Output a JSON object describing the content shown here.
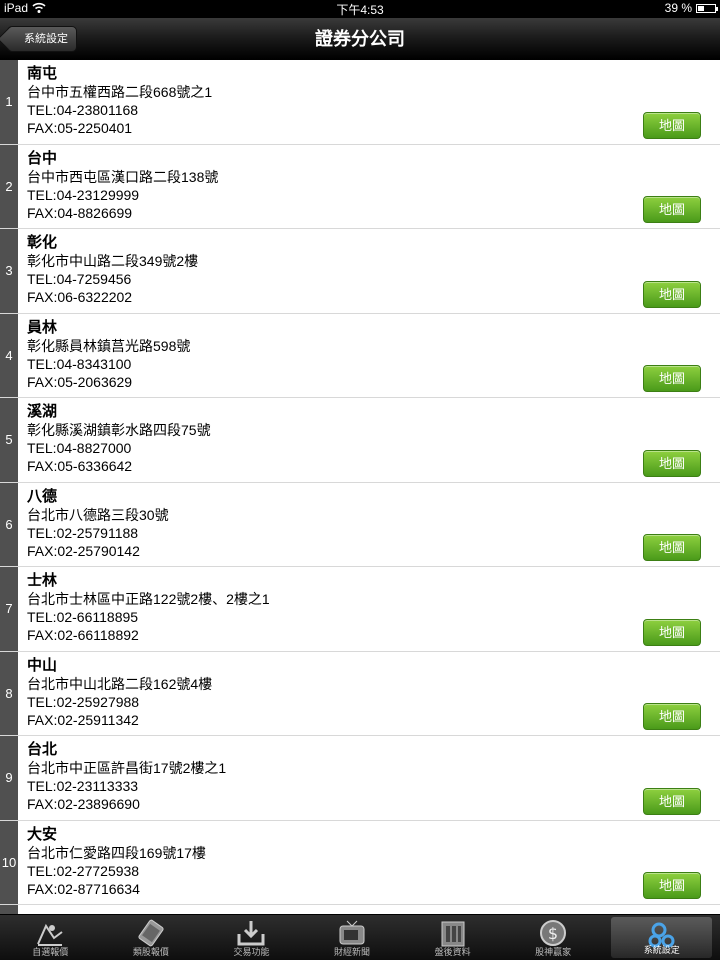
{
  "status_bar": {
    "device": "iPad",
    "time": "下午4:53",
    "battery": "39 %",
    "battery_level": 0.39
  },
  "nav": {
    "back_label": "系統設定",
    "title": "證券分公司"
  },
  "map_label": "地圖",
  "branches": [
    {
      "index": "1",
      "name": "南屯",
      "address": "台中市五權西路二段668號之1",
      "tel": "TEL:04-23801168",
      "fax": "FAX:05-2250401"
    },
    {
      "index": "2",
      "name": "台中",
      "address": "台中市西屯區漢口路二段138號",
      "tel": "TEL:04-23129999",
      "fax": "FAX:04-8826699"
    },
    {
      "index": "3",
      "name": "彰化",
      "address": "彰化市中山路二段349號2樓",
      "tel": "TEL:04-7259456",
      "fax": "FAX:06-6322202"
    },
    {
      "index": "4",
      "name": "員林",
      "address": "彰化縣員林鎮莒光路598號",
      "tel": "TEL:04-8343100",
      "fax": "FAX:05-2063629"
    },
    {
      "index": "5",
      "name": "溪湖",
      "address": "彰化縣溪湖鎮彰水路四段75號",
      "tel": "TEL:04-8827000",
      "fax": "FAX:05-6336642"
    },
    {
      "index": "6",
      "name": "八德",
      "address": "台北市八德路三段30號",
      "tel": "TEL:02-25791188",
      "fax": "FAX:02-25790142"
    },
    {
      "index": "7",
      "name": "士林",
      "address": "台北市士林區中正路122號2樓、2樓之1",
      "tel": "TEL:02-66118895",
      "fax": "FAX:02-66118892"
    },
    {
      "index": "8",
      "name": "中山",
      "address": "台北市中山北路二段162號4樓",
      "tel": "TEL:02-25927988",
      "fax": "FAX:02-25911342"
    },
    {
      "index": "9",
      "name": "台北",
      "address": "台北市中正區許昌街17號2樓之1",
      "tel": "TEL:02-23113333",
      "fax": "FAX:02-23896690"
    },
    {
      "index": "10",
      "name": "大安",
      "address": "台北市仁愛路四段169號17樓",
      "tel": "TEL:02-27725938",
      "fax": "FAX:02-87716634"
    }
  ],
  "tabs": [
    {
      "label": "自選報價",
      "icon": "person-chart-icon",
      "active": false
    },
    {
      "label": "類股報價",
      "icon": "cards-icon",
      "active": false
    },
    {
      "label": "交易功能",
      "icon": "download-tray-icon",
      "active": false
    },
    {
      "label": "財經新聞",
      "icon": "tv-icon",
      "active": false
    },
    {
      "label": "盤後資料",
      "icon": "building-icon",
      "active": false
    },
    {
      "label": "股神贏家",
      "icon": "dollar-coin-icon",
      "active": false
    },
    {
      "label": "系統設定",
      "icon": "gears-icon",
      "active": true
    }
  ]
}
